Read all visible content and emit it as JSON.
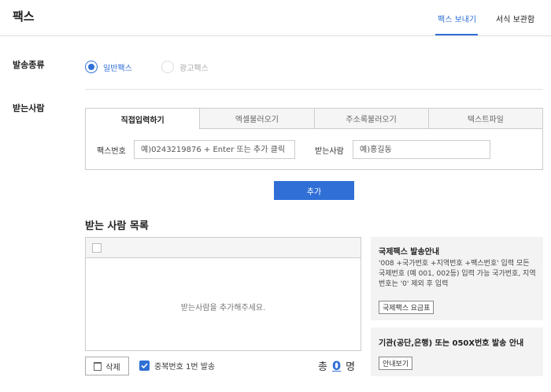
{
  "header": {
    "title": "팩스",
    "tabs": [
      {
        "label": "팩스 보내기",
        "active": true
      },
      {
        "label": "서식 보관함",
        "active": false
      }
    ]
  },
  "send_type": {
    "label": "발송종류",
    "options": [
      {
        "label": "일반팩스",
        "selected": true
      },
      {
        "label": "광고팩스",
        "selected": false
      }
    ]
  },
  "recipient": {
    "label": "받는사람",
    "tabs": [
      {
        "label": "직접입력하기",
        "active": true
      },
      {
        "label": "엑셀불러오기",
        "active": false
      },
      {
        "label": "주소록불러오기",
        "active": false
      },
      {
        "label": "텍스트파일",
        "active": false
      }
    ],
    "fax_label": "팩스번호",
    "fax_placeholder": "예)0243219876 + Enter 또는 추가 클릭",
    "name_label": "받는사람",
    "name_placeholder": "예)홍길동",
    "add_button": "추가"
  },
  "list": {
    "title": "받는 사람 목록",
    "empty_message": "받는사람을 추가해주세요.",
    "delete_button": "삭제",
    "dedupe_label": "중복번호 1번 발송",
    "dedupe_checked": true,
    "total_prefix": "총",
    "total_count": "0",
    "total_suffix": "명"
  },
  "info": {
    "international": {
      "title": "국제팩스 발송안내",
      "text": "'008 +국가번호 +지역번호 +팩스번호' 입력 모든 국제번호 (예 001, 002등) 입력 가능 국가번호, 지역번호는 '0' 제외 후 입력",
      "button": "국제팩스 요금표"
    },
    "institution": {
      "title": "기관(공단,은행) 또는 050X번호 발송 안내",
      "button": "안내보기"
    }
  },
  "colors": {
    "accent": "#2f6fd6",
    "panel": "#f3f3f3",
    "border": "#cccccc"
  }
}
